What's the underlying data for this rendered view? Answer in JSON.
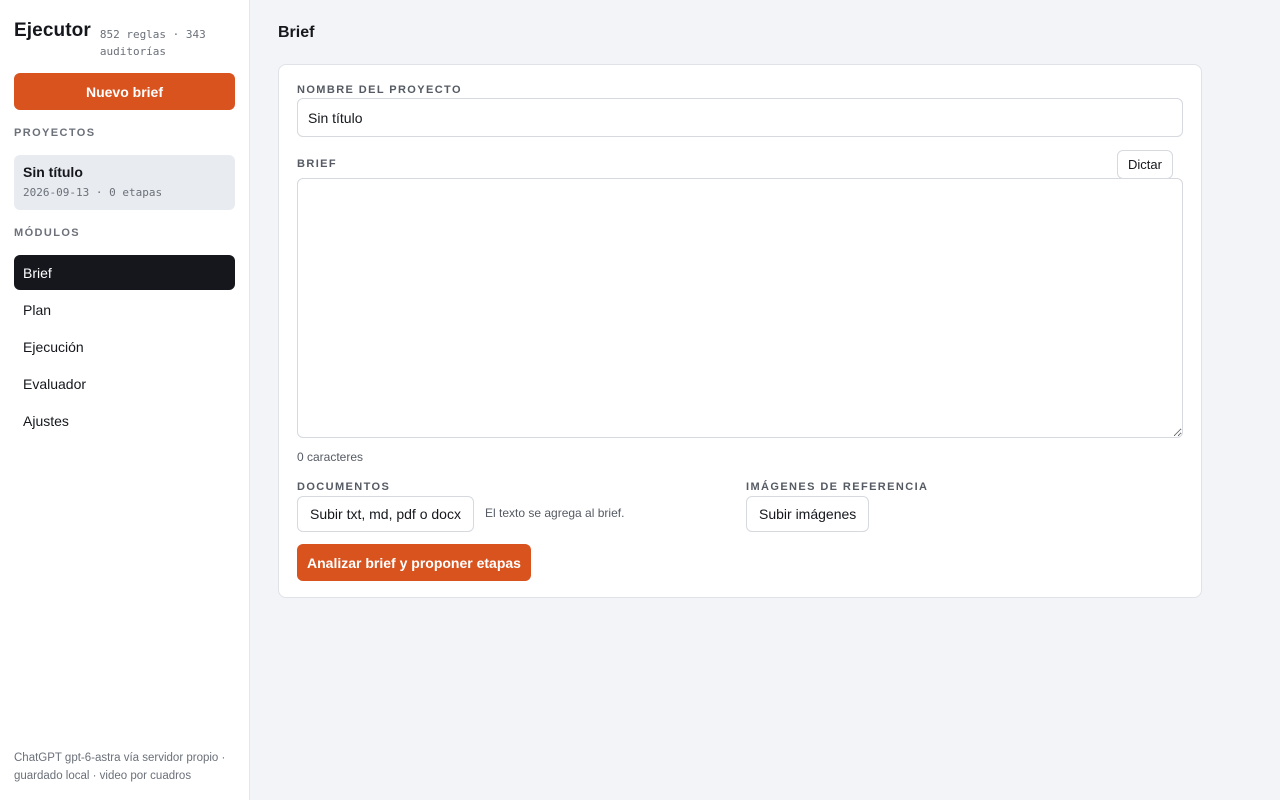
{
  "sidebar": {
    "app_title": "Ejecutor",
    "app_meta": "852 reglas · 343 auditorías",
    "new_button": "Nuevo brief",
    "projects_heading": "PROYECTOS",
    "project": {
      "name": "Sin título",
      "meta": "2026-09-13 · 0 etapas"
    },
    "modules_heading": "MÓDULOS",
    "modules": [
      {
        "label": "Brief",
        "active": true
      },
      {
        "label": "Plan",
        "active": false
      },
      {
        "label": "Ejecución",
        "active": false
      },
      {
        "label": "Evaluador",
        "active": false
      },
      {
        "label": "Ajustes",
        "active": false
      }
    ],
    "footer": "ChatGPT gpt-6-astra vía servidor propio · guardado local · video por cuadros"
  },
  "main": {
    "title": "Brief",
    "project_name_label": "NOMBRE DEL PROYECTO",
    "project_name_value": "Sin título",
    "brief_label": "BRIEF",
    "dictate_button": "Dictar",
    "brief_value": "",
    "char_count": "0 caracteres",
    "documents_label": "DOCUMENTOS",
    "documents_button": "Subir txt, md, pdf o docx",
    "documents_hint": "El texto se agrega al brief.",
    "images_label": "IMÁGENES DE REFERENCIA",
    "images_button": "Subir imágenes",
    "analyze_button": "Analizar brief y proponer etapas"
  },
  "colors": {
    "accent": "#d9531f",
    "active_nav": "#15171c",
    "background": "#f2f4f7"
  }
}
